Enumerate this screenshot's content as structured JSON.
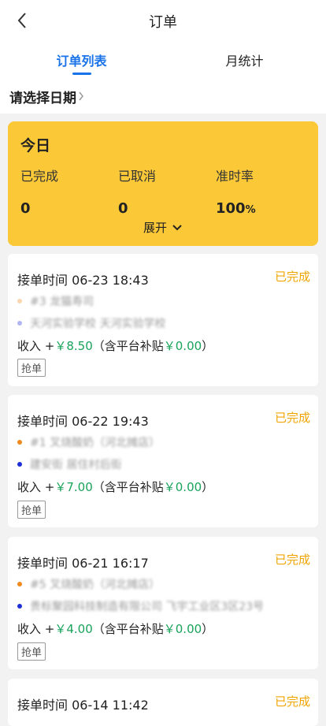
{
  "header": {
    "title": "订单",
    "back_icon": "back-chevron-icon"
  },
  "tabs": [
    {
      "label": "订单列表",
      "active": true
    },
    {
      "label": "月统计",
      "active": false
    }
  ],
  "date_selector": {
    "label": "请选择日期"
  },
  "summary": {
    "title": "今日",
    "stats": [
      {
        "label": "已完成",
        "value": "0"
      },
      {
        "label": "已取消",
        "value": "0"
      },
      {
        "label": "准时率",
        "value": "100",
        "unit": "%"
      }
    ],
    "expand_label": "展开"
  },
  "orders": [
    {
      "time_label": "接单时间 06-23 18:43",
      "status": "已完成",
      "pickup": "#3 龙猫寿司",
      "dropoff": "天河实验学校 天河实验学校",
      "income_prefix": "收入 +",
      "income": "￥8.50",
      "subsidy_prefix": "（含平台补贴",
      "subsidy": "￥0.00",
      "subsidy_suffix": "）",
      "grab_label": "抢单"
    },
    {
      "time_label": "接单时间 06-22 19:43",
      "status": "已完成",
      "pickup": "#1 叉烧酸奶（河北摊店）",
      "dropoff": "建安街 居住村后街",
      "income_prefix": "收入 +",
      "income": "￥7.00",
      "subsidy_prefix": "（含平台补贴",
      "subsidy": "￥0.00",
      "subsidy_suffix": "）",
      "grab_label": "抢单"
    },
    {
      "time_label": "接单时间 06-21 16:17",
      "status": "已完成",
      "pickup": "#5 叉烧酸奶（河北摊店）",
      "dropoff": "贵标聚园科技制造有限公司 飞宇工业区3区23号",
      "income_prefix": "收入 +",
      "income": "￥4.00",
      "subsidy_prefix": "（含平台补贴",
      "subsidy": "￥0.00",
      "subsidy_suffix": "）",
      "grab_label": "抢单"
    },
    {
      "time_label": "接单时间 06-14 11:42",
      "status": "已完成"
    }
  ],
  "colors": {
    "accent": "#1a73e8",
    "summary_bg": "#fbc838",
    "status": "#f0a500",
    "money": "#19a35a"
  }
}
